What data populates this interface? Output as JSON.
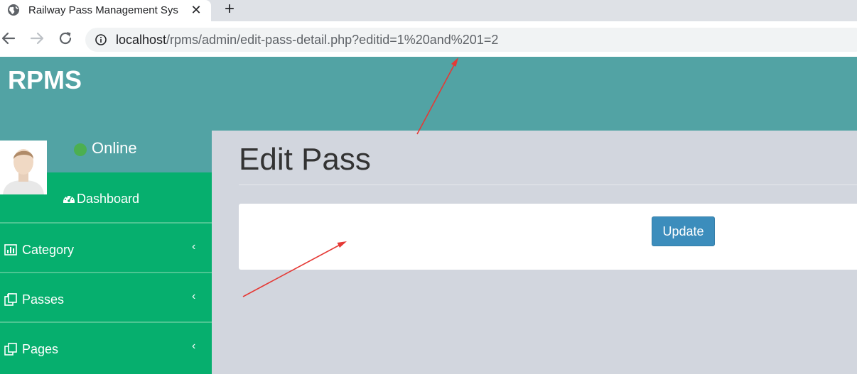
{
  "browser": {
    "tab_title": "Railway Pass Management Sys",
    "close_glyph": "✕",
    "new_tab_glyph": "+",
    "url_host": "localhost",
    "url_path": "/rpms/admin/edit-pass-detail.php?editid=1%20and%201=2"
  },
  "header": {
    "brand": "RPMS"
  },
  "user_panel": {
    "status": "Online"
  },
  "sidebar": {
    "items": [
      {
        "label": "Dashboard",
        "icon": "dashboard-icon"
      },
      {
        "label": "Category",
        "icon": "bar-chart-icon",
        "chevron": "‹"
      },
      {
        "label": "Passes",
        "icon": "copy-icon",
        "chevron": "‹"
      },
      {
        "label": "Pages",
        "icon": "copy-icon",
        "chevron": "‹"
      }
    ]
  },
  "main": {
    "title": "Edit Pass",
    "update_label": "Update"
  },
  "colors": {
    "header": "#52a3a4",
    "sidebar": "#06af6e",
    "button": "#3c8dbc",
    "annotation": "#e53935"
  }
}
